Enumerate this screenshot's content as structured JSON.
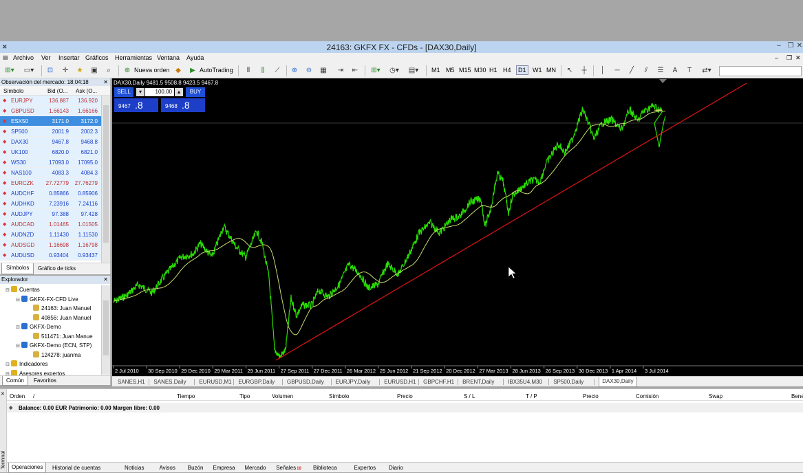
{
  "window": {
    "title": "24163: GKFX FX - CFDs - [DAX30,Daily]",
    "minimize": "–",
    "restore": "❐",
    "close": "✕"
  },
  "menu": [
    "Archivo",
    "Ver",
    "Insertar",
    "Gráficos",
    "Herramientas",
    "Ventana",
    "Ayuda"
  ],
  "toolbar": {
    "new_order": "Nueva orden",
    "autotrading": "AutoTrading",
    "timeframes": [
      "M1",
      "M5",
      "M15",
      "M30",
      "H1",
      "H4",
      "D1",
      "W1",
      "MN"
    ],
    "active_timeframe": "D1"
  },
  "market_watch": {
    "title": "Observación del mercado: 18:04:18",
    "columns": [
      "Símbolo",
      "Bid (O...",
      "Ask (O..."
    ],
    "rows": [
      {
        "symbol": "EURJPY",
        "bid": "136.887",
        "ask": "136.920",
        "color": "#c03030",
        "bg": "#e3f1ff"
      },
      {
        "symbol": "GBPUSD",
        "bid": "1.66143",
        "ask": "1.66166",
        "color": "#c03030",
        "bg": "#e3f1ff"
      },
      {
        "symbol": "ESX50",
        "bid": "3171.0",
        "ask": "3172.0",
        "color": "#ffffff",
        "bg": "#3d8ee0"
      },
      {
        "symbol": "SP500",
        "bid": "2001.9",
        "ask": "2002.3",
        "color": "#1a3ec8",
        "bg": "#e3f1ff"
      },
      {
        "symbol": "DAX30",
        "bid": "9467.8",
        "ask": "9468.8",
        "color": "#1a3ec8",
        "bg": "#e3f1ff"
      },
      {
        "symbol": "UK100",
        "bid": "6820.0",
        "ask": "6821.0",
        "color": "#1a3ec8",
        "bg": "#e3f1ff"
      },
      {
        "symbol": "WS30",
        "bid": "17093.0",
        "ask": "17095.0",
        "color": "#1a3ec8",
        "bg": "#e3f1ff"
      },
      {
        "symbol": "NAS100",
        "bid": "4083.3",
        "ask": "4084.3",
        "color": "#1a3ec8",
        "bg": "#e3f1ff"
      },
      {
        "symbol": "EURCZK",
        "bid": "27.72779",
        "ask": "27.76279",
        "color": "#c03030",
        "bg": "#e3f1ff"
      },
      {
        "symbol": "AUDCHF",
        "bid": "0.85866",
        "ask": "0.85906",
        "color": "#1a3ec8",
        "bg": "#e3f1ff"
      },
      {
        "symbol": "AUDHKD",
        "bid": "7.23916",
        "ask": "7.24116",
        "color": "#1a3ec8",
        "bg": "#e3f1ff"
      },
      {
        "symbol": "AUDJPY",
        "bid": "97.388",
        "ask": "97.428",
        "color": "#1a3ec8",
        "bg": "#e3f1ff"
      },
      {
        "symbol": "AUDCAD",
        "bid": "1.01465",
        "ask": "1.01505",
        "color": "#c03030",
        "bg": "#e3f1ff"
      },
      {
        "symbol": "AUDNZD",
        "bid": "1.11430",
        "ask": "1.11530",
        "color": "#1a3ec8",
        "bg": "#e3f1ff"
      },
      {
        "symbol": "AUDSGD",
        "bid": "1.16698",
        "ask": "1.16798",
        "color": "#c03030",
        "bg": "#e3f1ff"
      },
      {
        "symbol": "AUDUSD",
        "bid": "0.93404",
        "ask": "0.93437",
        "color": "#1a3ec8",
        "bg": "#e3f1ff"
      }
    ],
    "tabs": [
      "Símbolos",
      "Gráfico de ticks"
    ]
  },
  "navigator": {
    "title": "Explorador",
    "items": [
      {
        "label": "Cuentas",
        "level": 1
      },
      {
        "label": "GKFX-FX-CFD Live",
        "level": 2
      },
      {
        "label": "24163: Juan Manuel",
        "level": 3
      },
      {
        "label": "40856: Juan Manuel",
        "level": 3
      },
      {
        "label": "GKFX-Demo",
        "level": 2
      },
      {
        "label": "511471: Juan Manue",
        "level": 3
      },
      {
        "label": "GKFX-Demo (ECN, STP)",
        "level": 2
      },
      {
        "label": "124278: juanma",
        "level": 3
      },
      {
        "label": "Indicadores",
        "level": 1
      },
      {
        "label": "Asesores expertos",
        "level": 1
      }
    ],
    "tabs": [
      "Común",
      "Favoritos"
    ]
  },
  "chart": {
    "info": "DAX30,Daily  9481.5 9508.8 9423.5 9467.8",
    "sell_label": "SELL",
    "buy_label": "BUY",
    "lot": "100.00",
    "sell_price_main": "9467",
    "sell_price_frac": ".8",
    "buy_price_main": "9468",
    "buy_price_frac": ".8",
    "x_ticks": [
      "2 Jul 2010",
      "30 Sep 2010",
      "29 Dec 2010",
      "29 Mar 2011",
      "29 Jun 2011",
      "27 Sep 2011",
      "27 Dec 2011",
      "26 Mar 2012",
      "25 Jun 2012",
      "21 Sep 2012",
      "20 Dec 2012",
      "27 Mar 2013",
      "28 Jun 2013",
      "26 Sep 2013",
      "30 Dec 2013",
      "1 Apr 2014",
      "3 Jul 2014"
    ],
    "series_color": "#29e000",
    "ma_color": "#c8dc6e",
    "trendline_color": "#e01414"
  },
  "chart_tabs": [
    "SANES,H1",
    "SANES,Daily",
    "EURUSD,M1",
    "EURGBP,Daily",
    "GBPUSD,Daily",
    "EURJPY,Daily",
    "EURUSD,H1",
    "GBPCHF,H1",
    "BRENT,Daily",
    "IBX35U4,M30",
    "SP500,Daily",
    "DAX30,Daily"
  ],
  "active_chart_tab": "DAX30,Daily",
  "terminal": {
    "side_label": "Terminal",
    "columns": [
      "Orden",
      "/",
      "Tiempo",
      "Tipo",
      "Volumen",
      "Símbolo",
      "Precio",
      "S / L",
      "T / P",
      "Precio",
      "Comisión",
      "Swap",
      "Bene"
    ],
    "balance": "Balance: 0.00 EUR  Patrimonio: 0.00  Margen libre: 0.00",
    "tabs": [
      {
        "label": "Operaciones",
        "badge": ""
      },
      {
        "label": "Historial de cuentas",
        "badge": ""
      },
      {
        "label": "Noticias",
        "badge": ""
      },
      {
        "label": "Avisos",
        "badge": ""
      },
      {
        "label": "Buzón",
        "badge": ""
      },
      {
        "label": "Empresa",
        "badge": ""
      },
      {
        "label": "Mercado",
        "badge": ""
      },
      {
        "label": "Señales",
        "badge": "10"
      },
      {
        "label": "Biblioteca",
        "badge": ""
      },
      {
        "label": "Expertos",
        "badge": ""
      },
      {
        "label": "Diario",
        "badge": ""
      }
    ]
  }
}
